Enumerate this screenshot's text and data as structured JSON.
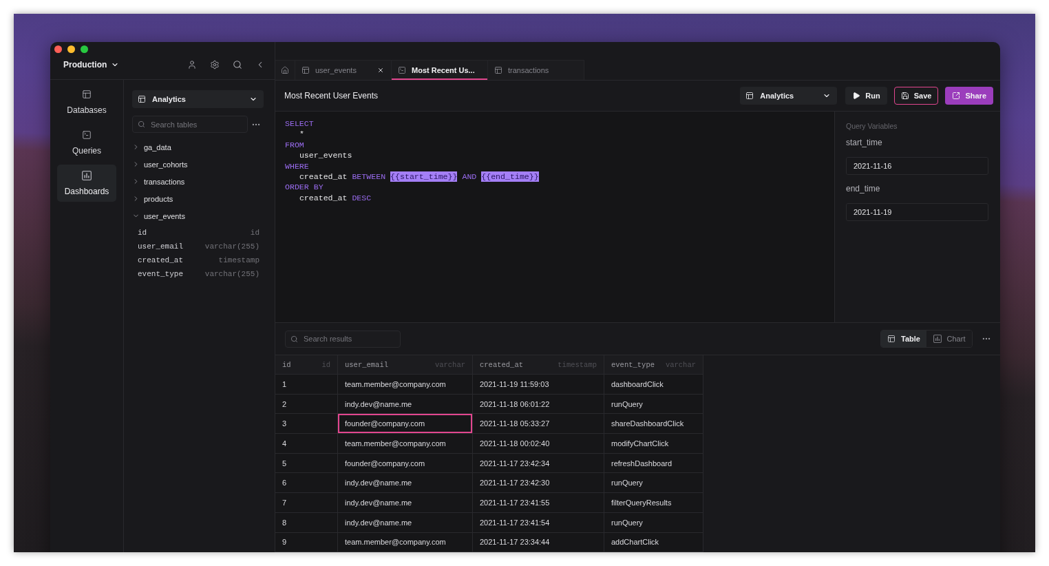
{
  "sidebar": {
    "environment": "Production",
    "nav": [
      {
        "kind": "databases",
        "label": "Databases",
        "selected": false
      },
      {
        "kind": "queries",
        "label": "Queries",
        "selected": false
      },
      {
        "kind": "dashboards",
        "label": "Dashboards",
        "selected": true
      }
    ],
    "schema": "Analytics",
    "search": {
      "placeholder": "Search tables"
    },
    "tree": [
      {
        "label": "ga_data",
        "expanded": false
      },
      {
        "label": "user_cohorts",
        "expanded": false
      },
      {
        "label": "transactions",
        "expanded": false
      },
      {
        "label": "products",
        "expanded": false
      },
      {
        "label": "user_events",
        "expanded": true,
        "children": [
          {
            "label": "id",
            "data_type": "id"
          },
          {
            "label": "user_email",
            "data_type": "varchar(255)"
          },
          {
            "label": "created_at",
            "data_type": "timestamp"
          },
          {
            "label": "event_type",
            "data_type": "varchar(255)"
          }
        ]
      }
    ]
  },
  "tabs": [
    {
      "kind": "home",
      "selected": false,
      "closable": false
    },
    {
      "kind": "table",
      "label": "user_events",
      "selected": false,
      "closable": true
    },
    {
      "kind": "query",
      "label": "Most Recent Us...",
      "selected": true,
      "closable": false
    },
    {
      "kind": "table",
      "label": "transactions",
      "selected": false,
      "closable": false
    }
  ],
  "query": {
    "title": "Most Recent User Events",
    "database": "Analytics",
    "actions": [
      {
        "kind": "run",
        "label": "Run"
      },
      {
        "kind": "save",
        "label": "Save"
      },
      {
        "kind": "share",
        "label": "Share"
      }
    ],
    "code": [
      {
        "kind": "clause",
        "tokens": [
          {
            "kind": "keyword",
            "text": "SELECT"
          }
        ]
      },
      {
        "kind": "body",
        "tokens": [
          {
            "kind": "ident",
            "text": "*"
          }
        ]
      },
      {
        "kind": "clause",
        "tokens": [
          {
            "kind": "keyword",
            "text": "FROM"
          }
        ]
      },
      {
        "kind": "body",
        "tokens": [
          {
            "kind": "ident",
            "text": "user_events"
          }
        ]
      },
      {
        "kind": "clause",
        "tokens": [
          {
            "kind": "keyword",
            "text": "WHERE"
          }
        ]
      },
      {
        "kind": "body",
        "tokens": [
          {
            "kind": "ident",
            "text": "created_at"
          },
          {
            "kind": "keyword",
            "text": "BETWEEN"
          },
          {
            "kind": "variable",
            "text": "{{start_time}}"
          },
          {
            "kind": "keyword",
            "text": "AND"
          },
          {
            "kind": "variable",
            "text": "{{end_time}}"
          }
        ]
      },
      {
        "kind": "clause",
        "tokens": [
          {
            "kind": "keyword",
            "text": "ORDER BY"
          }
        ]
      },
      {
        "kind": "body",
        "tokens": [
          {
            "kind": "ident",
            "text": "created_at"
          },
          {
            "kind": "keyword",
            "text": "DESC"
          }
        ]
      }
    ],
    "variables": {
      "heading": "Query Variables",
      "items": [
        {
          "name": "start_time",
          "value": "2021-11-16"
        },
        {
          "name": "end_time",
          "value": "2021-11-19"
        }
      ]
    }
  },
  "results": {
    "search": {
      "placeholder": "Search results"
    },
    "views": [
      {
        "kind": "table",
        "label": "Table",
        "selected": true
      },
      {
        "kind": "chart",
        "label": "Chart",
        "selected": false
      }
    ],
    "table": {
      "columns": [
        {
          "name": "id",
          "data_type": "id"
        },
        {
          "name": "user_email",
          "data_type": "varchar"
        },
        {
          "name": "created_at",
          "data_type": "timestamp"
        },
        {
          "name": "event_type",
          "data_type": "varchar"
        }
      ],
      "rows": [
        {
          "cells": [
            {
              "text": "1",
              "selected": false
            },
            {
              "text": "team.member@company.com",
              "selected": false
            },
            {
              "text": "2021-11-19 11:59:03",
              "selected": false
            },
            {
              "text": "dashboardClick",
              "selected": false
            }
          ]
        },
        {
          "cells": [
            {
              "text": "2",
              "selected": false
            },
            {
              "text": "indy.dev@name.me",
              "selected": false
            },
            {
              "text": "2021-11-18 06:01:22",
              "selected": false
            },
            {
              "text": "runQuery",
              "selected": false
            }
          ]
        },
        {
          "cells": [
            {
              "text": "3",
              "selected": false
            },
            {
              "text": "founder@company.com",
              "selected": true
            },
            {
              "text": "2021-11-18 05:33:27",
              "selected": false
            },
            {
              "text": "shareDashboardClick",
              "selected": false
            }
          ]
        },
        {
          "cells": [
            {
              "text": "4",
              "selected": false
            },
            {
              "text": "team.member@company.com",
              "selected": false
            },
            {
              "text": "2021-11-18 00:02:40",
              "selected": false
            },
            {
              "text": "modifyChartClick",
              "selected": false
            }
          ]
        },
        {
          "cells": [
            {
              "text": "5",
              "selected": false
            },
            {
              "text": "founder@company.com",
              "selected": false
            },
            {
              "text": "2021-11-17 23:42:34",
              "selected": false
            },
            {
              "text": "refreshDashboard",
              "selected": false
            }
          ]
        },
        {
          "cells": [
            {
              "text": "6",
              "selected": false
            },
            {
              "text": "indy.dev@name.me",
              "selected": false
            },
            {
              "text": "2021-11-17 23:42:30",
              "selected": false
            },
            {
              "text": "runQuery",
              "selected": false
            }
          ]
        },
        {
          "cells": [
            {
              "text": "7",
              "selected": false
            },
            {
              "text": "indy.dev@name.me",
              "selected": false
            },
            {
              "text": "2021-11-17 23:41:55",
              "selected": false
            },
            {
              "text": "filterQueryResults",
              "selected": false
            }
          ]
        },
        {
          "cells": [
            {
              "text": "8",
              "selected": false
            },
            {
              "text": "indy.dev@name.me",
              "selected": false
            },
            {
              "text": "2021-11-17 23:41:54",
              "selected": false
            },
            {
              "text": "runQuery",
              "selected": false
            }
          ]
        },
        {
          "cells": [
            {
              "text": "9",
              "selected": false
            },
            {
              "text": "team.member@company.com",
              "selected": false
            },
            {
              "text": "2021-11-17 23:34:44",
              "selected": false
            },
            {
              "text": "addChartClick",
              "selected": false
            }
          ]
        }
      ]
    }
  }
}
